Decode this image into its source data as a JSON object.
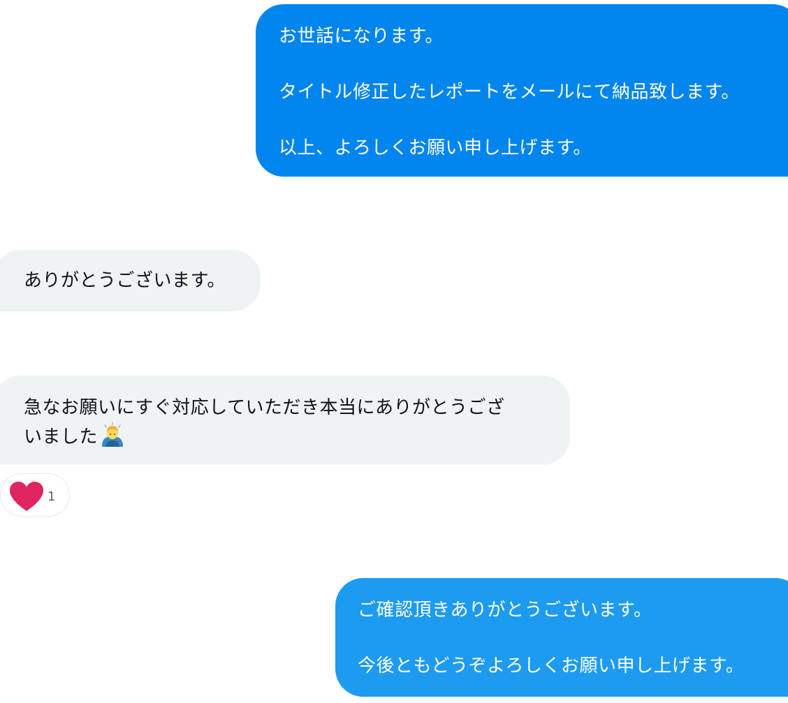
{
  "colors": {
    "outgoing_bubble_first": "#0085ee",
    "outgoing_bubble_last": "#1d9bf0",
    "incoming_bubble": "#eff3f4",
    "incoming_text": "#0f1419",
    "reaction_heart": "#e0245e"
  },
  "messages": [
    {
      "direction": "outgoing",
      "paragraphs": [
        "お世話になります。",
        "タイトル修正したレポートをメールにて納品致します。",
        "以上、よろしくお願い申し上げます。"
      ]
    },
    {
      "direction": "incoming",
      "paragraphs": [
        "ありがとうございます。"
      ]
    },
    {
      "direction": "incoming",
      "line1": "急なお願いにすぐ対応していただき本当にありがとうござ",
      "line2": "いました",
      "emoji": "person-bowing-icon",
      "reaction": {
        "icon": "heart-icon",
        "count": "1"
      }
    },
    {
      "direction": "outgoing",
      "paragraphs": [
        "ご確認頂きありがとうございます。",
        "今後ともどうぞよろしくお願い申し上げます。"
      ]
    }
  ]
}
